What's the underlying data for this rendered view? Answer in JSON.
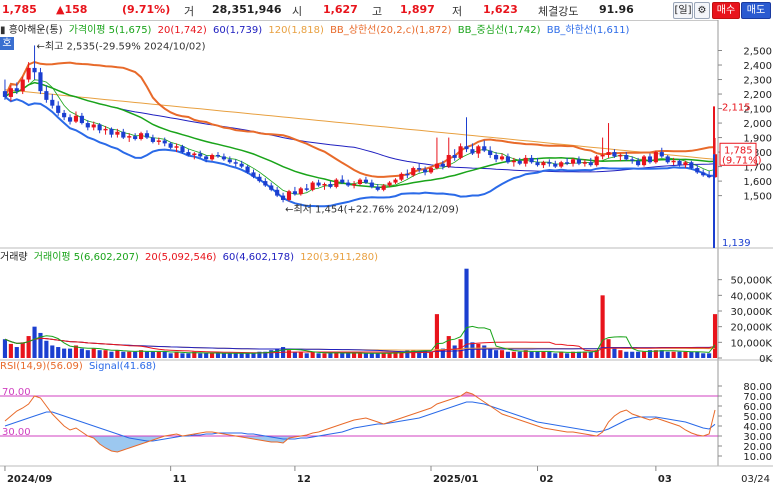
{
  "header": {
    "price": "1,785",
    "change": "▲158",
    "change_pct": "(9.71%)",
    "volume_label": "거",
    "volume": "28,351,946",
    "open_label": "시",
    "open": "1,627",
    "high_label": "고",
    "high": "1,897",
    "low_label": "저",
    "low": "1,623",
    "strength_label": "체결강도",
    "strength": "91.96",
    "period_button": "[일]",
    "settings_icon": "gear-icon",
    "buy_button": "매수",
    "sell_button": "매도"
  },
  "price_panel": {
    "stock_name": "흥아해운(통)",
    "legend": [
      {
        "label": "가격이평 5(1,675)",
        "color": "#1aa41a"
      },
      {
        "label": "20(1,742)",
        "color": "#e8141c"
      },
      {
        "label": "60(1,739)",
        "color": "#2020c0"
      },
      {
        "label": "120(1,818)",
        "color": "#e8a040"
      },
      {
        "label": "BB_상한선(20,2,c)(1,872)",
        "color": "#e86a2a"
      },
      {
        "label": "BB_중심선(1,742)",
        "color": "#1aa41a"
      },
      {
        "label": "BB_하한선(1,611)",
        "color": "#2a6ae8"
      }
    ],
    "mode_button": "호",
    "high_note": "←최고 2,535(-29.59% 2024/10/02)",
    "low_note": "←최저 1,454(+22.76% 2024/12/09)",
    "y_ticks": [
      "2,500",
      "2,400",
      "2,300",
      "2,200",
      "2,100",
      "2,000",
      "1,900",
      "1,800",
      "1,700",
      "1,600",
      "1,500"
    ],
    "current_label": "1,785",
    "current_pct_label": "(9.71%)",
    "top_tag": "2,115",
    "bottom_tag": "1,139",
    "ylim": [
      1139,
      2600
    ]
  },
  "volume_panel": {
    "title": "거래량",
    "legend": [
      {
        "label": "거래이평 5(6,602,207)",
        "color": "#1aa41a"
      },
      {
        "label": "20(5,092,546)",
        "color": "#e8141c"
      },
      {
        "label": "60(4,602,178)",
        "color": "#2020c0"
      },
      {
        "label": "120(3,911,280)",
        "color": "#e8a040"
      }
    ],
    "y_ticks": [
      "50,000K",
      "40,000K",
      "30,000K",
      "20,000K",
      "10,000K",
      "0K"
    ],
    "ylim": [
      0,
      60000
    ]
  },
  "rsi_panel": {
    "legend": [
      {
        "label": "RSI(14,9)(56.09)",
        "color": "#e86a2a"
      },
      {
        "label": "Signal(41.68)",
        "color": "#2a6ae8"
      }
    ],
    "y_ticks": [
      "80.00",
      "70.00",
      "60.00",
      "50.00",
      "40.00",
      "30.00",
      "20.00",
      "10.00"
    ],
    "upper_line_label": "70.00",
    "lower_line_label": "30.00",
    "ylim": [
      0,
      90
    ]
  },
  "x_axis": {
    "labels": [
      {
        "text": "2024/09",
        "index": 0
      },
      {
        "text": "11",
        "index": 28
      },
      {
        "text": "12",
        "index": 49
      },
      {
        "text": "2025/01",
        "index": 72
      },
      {
        "text": "02",
        "index": 90
      },
      {
        "text": "03",
        "index": 110
      }
    ],
    "end_label": "03/24"
  },
  "chart_data": {
    "type": "candlestick",
    "candles": [
      [
        2220,
        2300,
        2160,
        2180
      ],
      [
        2180,
        2260,
        2150,
        2240
      ],
      [
        2240,
        2280,
        2200,
        2220
      ],
      [
        2220,
        2320,
        2200,
        2300
      ],
      [
        2300,
        2420,
        2280,
        2380
      ],
      [
        2380,
        2535,
        2300,
        2350
      ],
      [
        2350,
        2380,
        2200,
        2220
      ],
      [
        2220,
        2260,
        2140,
        2160
      ],
      [
        2160,
        2200,
        2100,
        2120
      ],
      [
        2120,
        2150,
        2050,
        2070
      ],
      [
        2070,
        2090,
        2020,
        2040
      ],
      [
        2040,
        2060,
        1990,
        2010
      ],
      [
        2010,
        2080,
        2000,
        2050
      ],
      [
        2050,
        2070,
        1990,
        2000
      ],
      [
        2000,
        2020,
        1950,
        1970
      ],
      [
        1970,
        2010,
        1950,
        1990
      ],
      [
        1990,
        2000,
        1930,
        1950
      ],
      [
        1950,
        1980,
        1920,
        1960
      ],
      [
        1960,
        1970,
        1900,
        1920
      ],
      [
        1920,
        1960,
        1900,
        1940
      ],
      [
        1940,
        1960,
        1890,
        1900
      ],
      [
        1900,
        1930,
        1870,
        1910
      ],
      [
        1910,
        1930,
        1880,
        1890
      ],
      [
        1890,
        1940,
        1880,
        1930
      ],
      [
        1930,
        1950,
        1890,
        1900
      ],
      [
        1900,
        1920,
        1860,
        1870
      ],
      [
        1870,
        1900,
        1850,
        1880
      ],
      [
        1880,
        1900,
        1840,
        1860
      ],
      [
        1860,
        1870,
        1820,
        1830
      ],
      [
        1830,
        1860,
        1800,
        1840
      ],
      [
        1840,
        1850,
        1790,
        1800
      ],
      [
        1800,
        1820,
        1770,
        1780
      ],
      [
        1780,
        1800,
        1750,
        1790
      ],
      [
        1790,
        1810,
        1760,
        1770
      ],
      [
        1770,
        1780,
        1730,
        1750
      ],
      [
        1750,
        1790,
        1740,
        1780
      ],
      [
        1780,
        1800,
        1760,
        1770
      ],
      [
        1770,
        1790,
        1740,
        1750
      ],
      [
        1750,
        1770,
        1720,
        1730
      ],
      [
        1730,
        1750,
        1700,
        1720
      ],
      [
        1720,
        1740,
        1690,
        1700
      ],
      [
        1700,
        1710,
        1650,
        1660
      ],
      [
        1660,
        1680,
        1620,
        1630
      ],
      [
        1630,
        1650,
        1590,
        1600
      ],
      [
        1600,
        1620,
        1560,
        1570
      ],
      [
        1570,
        1590,
        1530,
        1540
      ],
      [
        1540,
        1560,
        1490,
        1500
      ],
      [
        1500,
        1520,
        1454,
        1470
      ],
      [
        1470,
        1540,
        1460,
        1530
      ],
      [
        1530,
        1560,
        1500,
        1510
      ],
      [
        1510,
        1560,
        1500,
        1550
      ],
      [
        1550,
        1580,
        1530,
        1540
      ],
      [
        1540,
        1600,
        1530,
        1590
      ],
      [
        1590,
        1610,
        1560,
        1570
      ],
      [
        1570,
        1590,
        1540,
        1580
      ],
      [
        1580,
        1600,
        1550,
        1560
      ],
      [
        1560,
        1620,
        1550,
        1610
      ],
      [
        1610,
        1640,
        1580,
        1590
      ],
      [
        1590,
        1610,
        1560,
        1570
      ],
      [
        1570,
        1600,
        1550,
        1580
      ],
      [
        1580,
        1620,
        1570,
        1610
      ],
      [
        1610,
        1630,
        1580,
        1590
      ],
      [
        1590,
        1610,
        1550,
        1560
      ],
      [
        1560,
        1580,
        1530,
        1540
      ],
      [
        1540,
        1580,
        1530,
        1570
      ],
      [
        1570,
        1600,
        1560,
        1590
      ],
      [
        1590,
        1620,
        1580,
        1610
      ],
      [
        1610,
        1660,
        1600,
        1650
      ],
      [
        1650,
        1680,
        1620,
        1640
      ],
      [
        1640,
        1700,
        1630,
        1690
      ],
      [
        1690,
        1720,
        1660,
        1680
      ],
      [
        1680,
        1700,
        1640,
        1660
      ],
      [
        1660,
        1700,
        1650,
        1690
      ],
      [
        1690,
        1900,
        1680,
        1720
      ],
      [
        1720,
        1740,
        1680,
        1700
      ],
      [
        1700,
        1900,
        1690,
        1780
      ],
      [
        1780,
        1820,
        1740,
        1760
      ],
      [
        1760,
        1860,
        1750,
        1840
      ],
      [
        1840,
        2040,
        1800,
        1820
      ],
      [
        1820,
        1860,
        1780,
        1790
      ],
      [
        1790,
        1850,
        1760,
        1840
      ],
      [
        1840,
        1880,
        1800,
        1810
      ],
      [
        1810,
        1840,
        1760,
        1780
      ],
      [
        1780,
        1800,
        1730,
        1750
      ],
      [
        1750,
        1790,
        1740,
        1770
      ],
      [
        1770,
        1790,
        1720,
        1730
      ],
      [
        1730,
        1760,
        1700,
        1740
      ],
      [
        1740,
        1760,
        1710,
        1720
      ],
      [
        1720,
        1780,
        1700,
        1760
      ],
      [
        1760,
        1780,
        1720,
        1730
      ],
      [
        1730,
        1760,
        1700,
        1710
      ],
      [
        1710,
        1740,
        1690,
        1730
      ],
      [
        1730,
        1750,
        1700,
        1720
      ],
      [
        1720,
        1740,
        1690,
        1700
      ],
      [
        1700,
        1740,
        1690,
        1730
      ],
      [
        1730,
        1760,
        1710,
        1720
      ],
      [
        1720,
        1760,
        1700,
        1750
      ],
      [
        1750,
        1770,
        1710,
        1720
      ],
      [
        1720,
        1750,
        1700,
        1730
      ],
      [
        1730,
        1760,
        1700,
        1710
      ],
      [
        1710,
        1780,
        1700,
        1770
      ],
      [
        1770,
        1900,
        1750,
        1780
      ],
      [
        1780,
        2000,
        1760,
        1800
      ],
      [
        1800,
        1820,
        1760,
        1770
      ],
      [
        1770,
        1790,
        1740,
        1780
      ],
      [
        1780,
        1800,
        1740,
        1750
      ],
      [
        1750,
        1770,
        1720,
        1740
      ],
      [
        1740,
        1760,
        1700,
        1710
      ],
      [
        1710,
        1780,
        1700,
        1770
      ],
      [
        1770,
        1790,
        1720,
        1730
      ],
      [
        1730,
        1810,
        1720,
        1800
      ],
      [
        1800,
        1830,
        1760,
        1770
      ],
      [
        1770,
        1780,
        1720,
        1730
      ],
      [
        1730,
        1760,
        1710,
        1740
      ],
      [
        1740,
        1750,
        1700,
        1710
      ],
      [
        1710,
        1740,
        1690,
        1730
      ],
      [
        1730,
        1740,
        1680,
        1690
      ],
      [
        1690,
        1710,
        1650,
        1660
      ],
      [
        1660,
        1680,
        1630,
        1640
      ],
      [
        1640,
        1670,
        1620,
        1627
      ],
      [
        1627,
        1897,
        1623,
        1785
      ]
    ],
    "volume": [
      12,
      9,
      7,
      10,
      14,
      20,
      16,
      11,
      8,
      7,
      6,
      6,
      8,
      6,
      5,
      6,
      5,
      5,
      4,
      5,
      4,
      4,
      4,
      5,
      4,
      4,
      4,
      4,
      3,
      4,
      3,
      3,
      4,
      3,
      3,
      3,
      3,
      3,
      3,
      3,
      3,
      3,
      3,
      4,
      4,
      5,
      6,
      7,
      5,
      4,
      4,
      3,
      4,
      3,
      3,
      3,
      4,
      3,
      3,
      3,
      3,
      3,
      3,
      3,
      3,
      3,
      4,
      4,
      5,
      5,
      4,
      5,
      4,
      28,
      6,
      14,
      8,
      12,
      57,
      10,
      9,
      8,
      6,
      5,
      5,
      4,
      4,
      4,
      5,
      4,
      4,
      4,
      4,
      3,
      4,
      3,
      4,
      4,
      4,
      4,
      5,
      40,
      12,
      6,
      5,
      4,
      4,
      4,
      4,
      5,
      5,
      5,
      4,
      4,
      4,
      4,
      4,
      4,
      3,
      3,
      28
    ],
    "rsi": [
      45,
      50,
      55,
      58,
      62,
      70,
      68,
      60,
      52,
      46,
      40,
      36,
      38,
      34,
      30,
      28,
      22,
      18,
      15,
      14,
      16,
      18,
      20,
      22,
      24,
      26,
      28,
      30,
      31,
      32,
      30,
      31,
      32,
      33,
      34,
      34,
      33,
      32,
      31,
      30,
      29,
      28,
      27,
      26,
      25,
      24,
      24,
      23,
      28,
      29,
      30,
      31,
      33,
      34,
      36,
      38,
      40,
      42,
      44,
      46,
      47,
      48,
      46,
      44,
      42,
      44,
      46,
      48,
      50,
      52,
      54,
      56,
      58,
      62,
      64,
      66,
      68,
      70,
      74,
      72,
      68,
      64,
      60,
      56,
      52,
      50,
      48,
      46,
      44,
      42,
      40,
      38,
      37,
      36,
      35,
      34,
      34,
      33,
      32,
      31,
      30,
      34,
      44,
      50,
      54,
      56,
      52,
      50,
      48,
      46,
      48,
      46,
      44,
      42,
      40,
      36,
      33,
      31,
      30,
      32,
      56
    ],
    "signal": [
      40,
      42,
      44,
      46,
      48,
      50,
      52,
      54,
      54,
      52,
      50,
      48,
      46,
      44,
      42,
      40,
      38,
      36,
      34,
      32,
      30,
      28,
      27,
      26,
      25,
      25,
      26,
      27,
      28,
      29,
      30,
      30,
      31,
      31,
      32,
      32,
      33,
      33,
      33,
      33,
      33,
      32,
      32,
      31,
      30,
      29,
      28,
      27,
      27,
      27,
      28,
      28,
      29,
      30,
      31,
      32,
      33,
      34,
      36,
      38,
      39,
      40,
      41,
      42,
      42,
      43,
      44,
      45,
      46,
      47,
      48,
      50,
      52,
      54,
      56,
      58,
      60,
      62,
      64,
      64,
      63,
      62,
      60,
      58,
      56,
      54,
      52,
      50,
      48,
      46,
      44,
      43,
      42,
      41,
      40,
      39,
      38,
      37,
      36,
      35,
      34,
      35,
      37,
      40,
      43,
      46,
      48,
      49,
      49,
      49,
      49,
      48,
      47,
      46,
      45,
      44,
      42,
      40,
      38,
      37,
      41.68
    ]
  }
}
